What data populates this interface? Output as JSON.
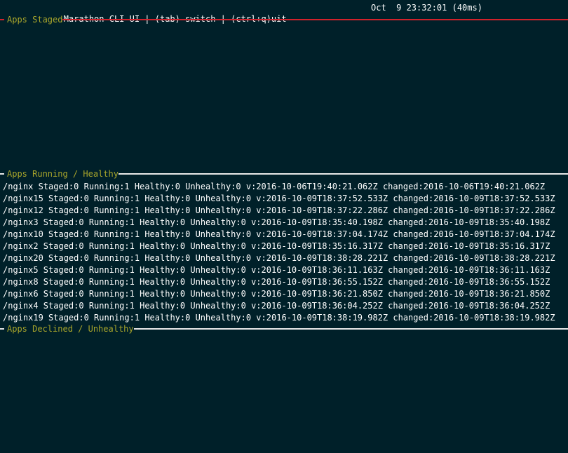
{
  "window": {
    "title": "MCLUI - Marathon CLI UI | (tab) switch | (ctrl+q)uit",
    "clock": "Oct  9 23:32:01 (40ms)"
  },
  "colors": {
    "background": "#002029",
    "header_label": "#a8a52b",
    "active_rule": "#d1222b",
    "inactive_rule": "#e8e8e8",
    "text": "#ffffff"
  },
  "panes": {
    "staged": {
      "label": "Apps Staged",
      "active": true
    },
    "running": {
      "label": "Apps Running / Healthy",
      "active": false
    },
    "declined": {
      "label": "Apps Declined / Unhealthy",
      "active": false
    }
  },
  "running_apps": [
    {
      "id": "/nginx",
      "staged": "0",
      "running": "1",
      "healthy": "0",
      "unhealthy": "0",
      "version": "2016-10-06T19:40:21.062Z",
      "changed": "2016-10-06T19:40:21.062Z"
    },
    {
      "id": "/nginx15",
      "staged": "0",
      "running": "1",
      "healthy": "0",
      "unhealthy": "0",
      "version": "2016-10-09T18:37:52.533Z",
      "changed": "2016-10-09T18:37:52.533Z"
    },
    {
      "id": "/nginx12",
      "staged": "0",
      "running": "1",
      "healthy": "0",
      "unhealthy": "0",
      "version": "2016-10-09T18:37:22.286Z",
      "changed": "2016-10-09T18:37:22.286Z"
    },
    {
      "id": "/nginx3",
      "staged": "0",
      "running": "1",
      "healthy": "0",
      "unhealthy": "0",
      "version": "2016-10-09T18:35:40.198Z",
      "changed": "2016-10-09T18:35:40.198Z"
    },
    {
      "id": "/nginx10",
      "staged": "0",
      "running": "1",
      "healthy": "0",
      "unhealthy": "0",
      "version": "2016-10-09T18:37:04.174Z",
      "changed": "2016-10-09T18:37:04.174Z"
    },
    {
      "id": "/nginx2",
      "staged": "0",
      "running": "1",
      "healthy": "0",
      "unhealthy": "0",
      "version": "2016-10-09T18:35:16.317Z",
      "changed": "2016-10-09T18:35:16.317Z"
    },
    {
      "id": "/nginx20",
      "staged": "0",
      "running": "1",
      "healthy": "0",
      "unhealthy": "0",
      "version": "2016-10-09T18:38:28.221Z",
      "changed": "2016-10-09T18:38:28.221Z"
    },
    {
      "id": "/nginx5",
      "staged": "0",
      "running": "1",
      "healthy": "0",
      "unhealthy": "0",
      "version": "2016-10-09T18:36:11.163Z",
      "changed": "2016-10-09T18:36:11.163Z"
    },
    {
      "id": "/nginx8",
      "staged": "0",
      "running": "1",
      "healthy": "0",
      "unhealthy": "0",
      "version": "2016-10-09T18:36:55.152Z",
      "changed": "2016-10-09T18:36:55.152Z"
    },
    {
      "id": "/nginx6",
      "staged": "0",
      "running": "1",
      "healthy": "0",
      "unhealthy": "0",
      "version": "2016-10-09T18:36:21.850Z",
      "changed": "2016-10-09T18:36:21.850Z"
    },
    {
      "id": "/nginx4",
      "staged": "0",
      "running": "1",
      "healthy": "0",
      "unhealthy": "0",
      "version": "2016-10-09T18:36:04.252Z",
      "changed": "2016-10-09T18:36:04.252Z"
    },
    {
      "id": "/nginx19",
      "staged": "0",
      "running": "1",
      "healthy": "0",
      "unhealthy": "0",
      "version": "2016-10-09T18:38:19.982Z",
      "changed": "2016-10-09T18:38:19.982Z"
    }
  ]
}
